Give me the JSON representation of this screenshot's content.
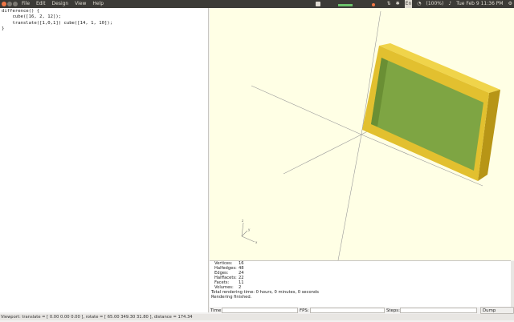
{
  "menu": [
    "File",
    "Edit",
    "Design",
    "View",
    "Help"
  ],
  "tray": {
    "battery": "(100%)",
    "clock": "Tue Feb 9 11:36 PM"
  },
  "editor": {
    "lines": [
      "difference() {",
      "    cube([16, 2, 12]);",
      "    translate([1,0,1]) cube([14, 1, 10]);",
      "}"
    ]
  },
  "console": {
    "stats": [
      {
        "label": "Vertices:",
        "value": "16"
      },
      {
        "label": "Halfedges:",
        "value": "48"
      },
      {
        "label": "Edges:",
        "value": "24"
      },
      {
        "label": "Halffacets:",
        "value": "22"
      },
      {
        "label": "Facets:",
        "value": "11"
      },
      {
        "label": "Volumes:",
        "value": "2"
      }
    ],
    "render_time": "Total rendering time: 0 hours, 0 minutes, 0 seconds",
    "render_done": "Rendering finished."
  },
  "toolbar": {
    "time_label": "Time:",
    "fps_label": "FPS:",
    "steps_label": "Steps:",
    "dump_button": "Dump Pictures"
  },
  "status": {
    "viewport": "Viewport: translate = [ 0.00 0.00 0.00 ], rotate = [ 65.00 349.30 31.80 ], distance = 174.34"
  },
  "colors": {
    "frame": "#e2c02f",
    "frame_dark": "#c9a619",
    "inner": "#7ea543",
    "viewport_bg": "#ffffe5"
  }
}
